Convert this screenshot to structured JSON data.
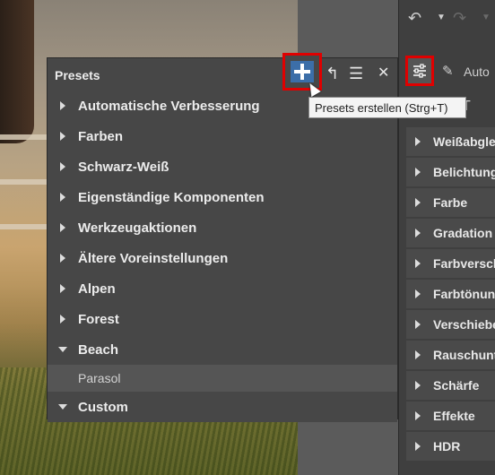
{
  "presets_panel": {
    "title": "Presets",
    "add_tooltip": "Presets erstellen (Strg+T)",
    "items": [
      {
        "label": "Automatische Verbesserung",
        "expanded": false
      },
      {
        "label": "Farben",
        "expanded": false
      },
      {
        "label": "Schwarz-Weiß",
        "expanded": false
      },
      {
        "label": "Eigenständige Komponenten",
        "expanded": false
      },
      {
        "label": "Werkzeugaktionen",
        "expanded": false
      },
      {
        "label": "Ältere Voreinstellungen",
        "expanded": false
      },
      {
        "label": "Alpen",
        "expanded": false
      },
      {
        "label": "Forest",
        "expanded": false
      },
      {
        "label": "Beach",
        "expanded": true
      },
      {
        "label": "Custom",
        "expanded": true
      }
    ],
    "beach_children": [
      "Parasol"
    ]
  },
  "right_panel": {
    "auto_label": "Auto",
    "sections": [
      "Weißabgleich",
      "Belichtung",
      "Farbe",
      "Gradation",
      "Farbverschiebung",
      "Farbtönung",
      "Verschieben",
      "Rauschunterdrückung",
      "Schärfe",
      "Effekte",
      "HDR"
    ]
  },
  "colors": {
    "highlight": "#e00000",
    "accent": "#3c6ea8"
  }
}
